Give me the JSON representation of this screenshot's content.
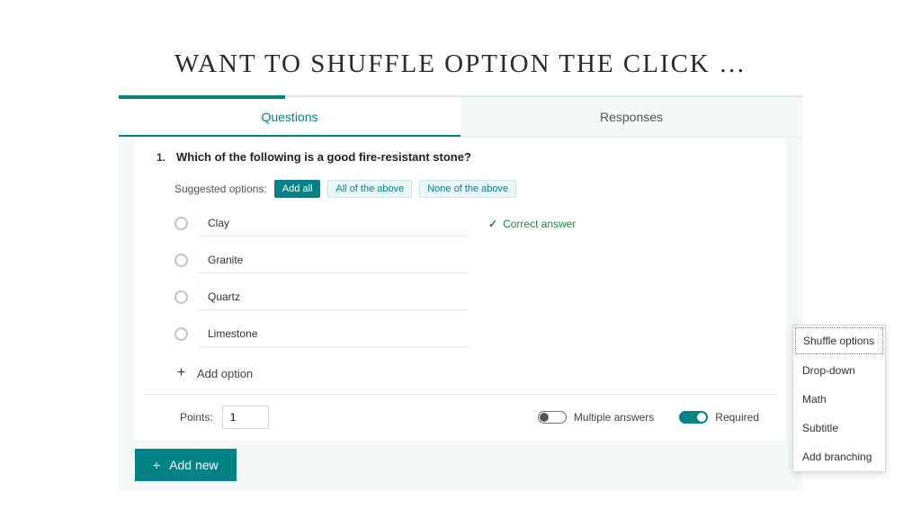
{
  "slide": {
    "title": "WANT TO SHUFFLE OPTION THE CLICK …"
  },
  "tabs": {
    "questions": "Questions",
    "responses": "Responses"
  },
  "question": {
    "number": "1.",
    "text": "Which of the following is a good fire-resistant stone?",
    "suggested_label": "Suggested options:",
    "suggested": {
      "add_all": "Add all",
      "all_above": "All of the above",
      "none_above": "None of the above"
    },
    "options": [
      "Clay",
      "Granite",
      "Quartz",
      "Limestone"
    ],
    "correct_label": "Correct answer",
    "add_option": "Add option"
  },
  "footer": {
    "points_label": "Points:",
    "points_value": "1",
    "multiple_label": "Multiple answers",
    "required_label": "Required"
  },
  "add_new": "Add new",
  "menu": {
    "shuffle": "Shuffle options",
    "dropdown": "Drop-down",
    "math": "Math",
    "subtitle": "Subtitle",
    "branching": "Add branching"
  }
}
